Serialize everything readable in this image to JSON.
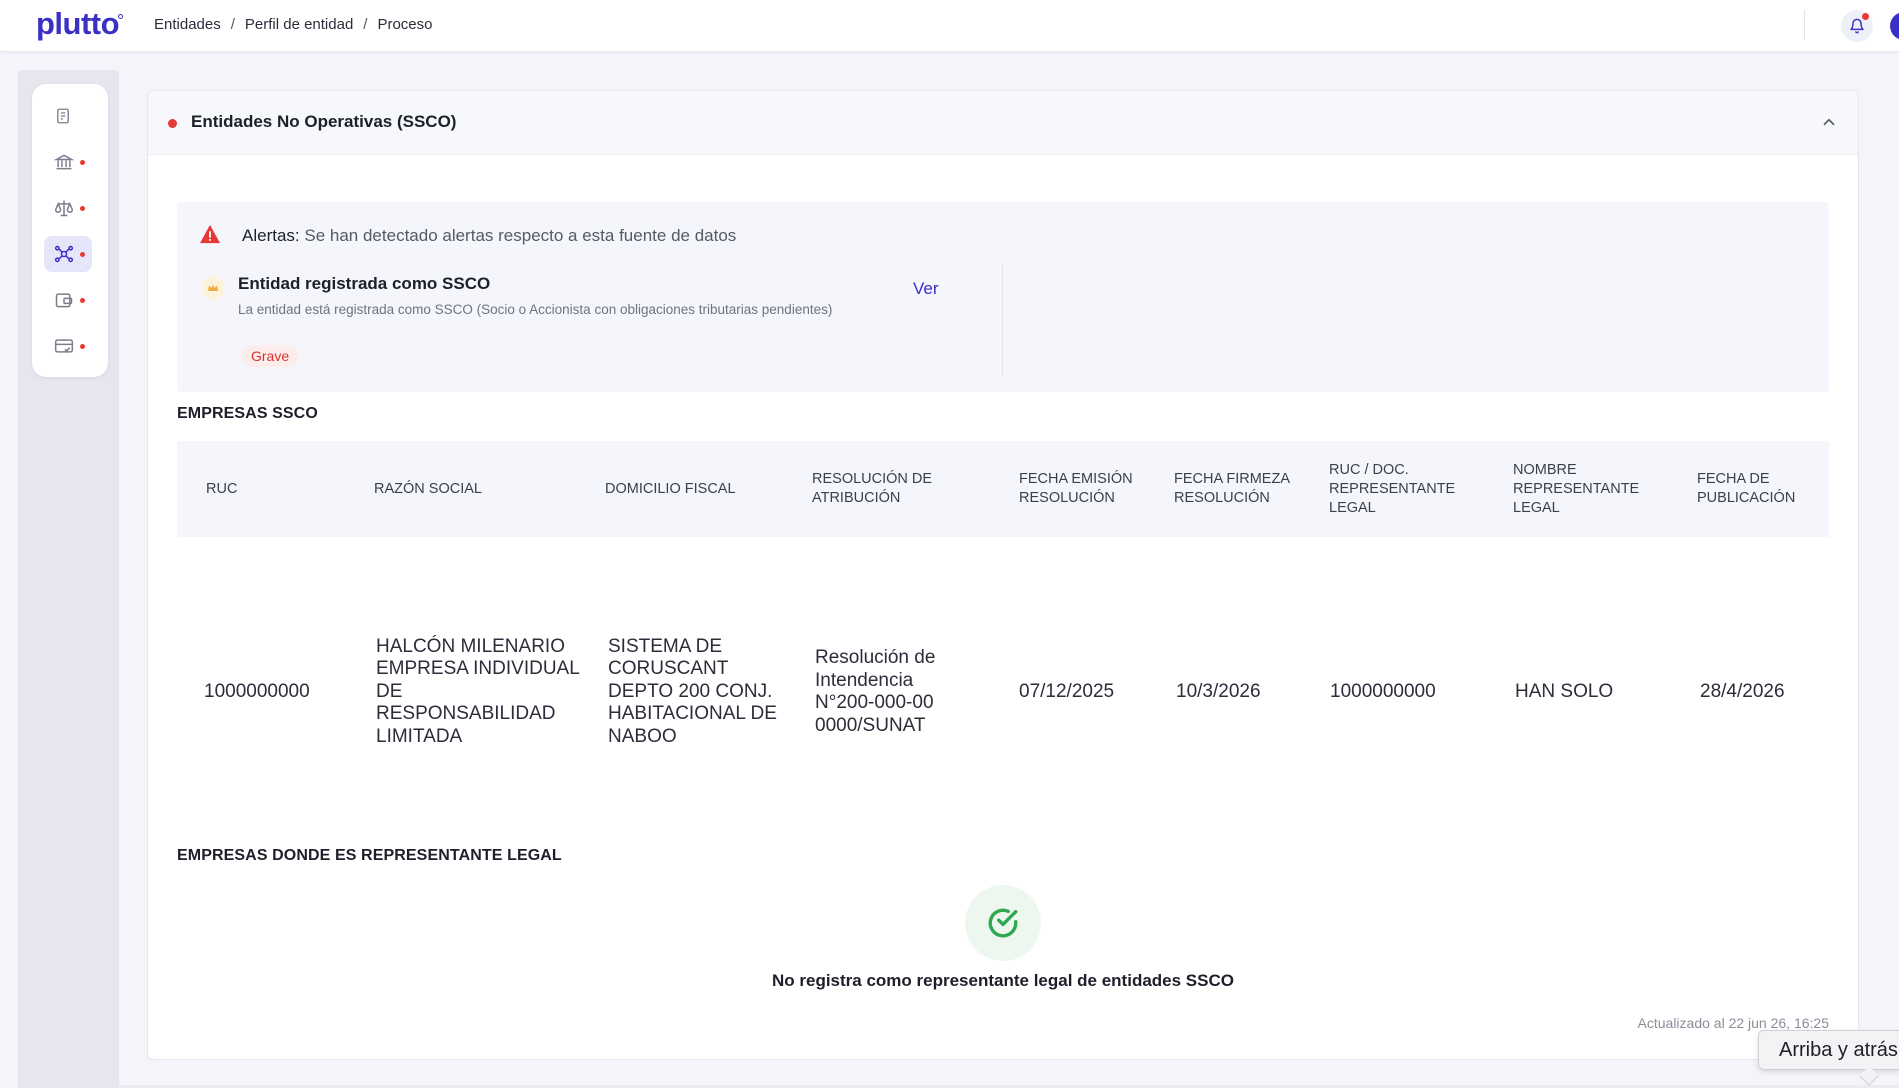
{
  "app": {
    "logo": "plutto"
  },
  "breadcrumb": [
    "Entidades",
    "Perfil de entidad",
    "Proceso"
  ],
  "breadcrumb_separator": "/",
  "sidebar": {
    "items": [
      {
        "icon": "document-icon",
        "alert": false,
        "active": false
      },
      {
        "icon": "bank-icon",
        "alert": true,
        "active": false
      },
      {
        "icon": "scales-icon",
        "alert": true,
        "active": false
      },
      {
        "icon": "network-icon",
        "alert": true,
        "active": true
      },
      {
        "icon": "wallet-icon",
        "alert": true,
        "active": false
      },
      {
        "icon": "card-check-icon",
        "alert": true,
        "active": false
      }
    ]
  },
  "panel": {
    "title": "Entidades No Operativas (SSCO)",
    "status_color": "#e53935",
    "alerts": {
      "label": "Alertas:",
      "message": "Se han detectado alertas respecto a esta fuente de datos",
      "item": {
        "title": "Entidad registrada como SSCO",
        "description": "La entidad está registrada como SSCO (Socio o Accionista con obligaciones tributarias pendientes)",
        "severity": "Grave",
        "link_label": "Ver"
      }
    },
    "ssco_section": {
      "title": "EMPRESAS SSCO",
      "columns": [
        "RUC",
        "RAZÓN SOCIAL",
        "DOMICILIO FISCAL",
        "RESOLUCIÓN DE ATRIBUCIÓN",
        "FECHA EMISIÓN RESOLUCIÓN",
        "FECHA FIRMEZA RESOLUCIÓN",
        "RUC / DOC. REPRESENTANTE LEGAL",
        "NOMBRE REPRESENTANTE LEGAL",
        "FECHA DE PUBLICACIÓN"
      ],
      "rows": [
        [
          "1000000000",
          "HALCÓN MILENARIO EMPRESA INDIVIDUAL DE RESPONSABILIDAD LIMITADA",
          "SISTEMA DE CORUSCANT DEPTO 200 CONJ. HABITACIONAL DE NABOO",
          "Resolución de Intendencia N°200-000-00 0000/SUNAT",
          "07/12/2025",
          "10/3/2026",
          "1000000000",
          "HAN SOLO",
          "28/4/2026"
        ]
      ]
    },
    "legal_rep_section": {
      "title": "EMPRESAS DONDE ES REPRESENTANTE LEGAL",
      "empty_message": "No registra como representante legal de entidades SSCO"
    },
    "updated": "Actualizado al 22 jun 26, 16:25"
  },
  "tooltip": "Arriba y atrás",
  "colors": {
    "brand": "#3a2fc6",
    "danger": "#e53935",
    "success": "#2fa84f",
    "warning": "#f2a93b"
  }
}
